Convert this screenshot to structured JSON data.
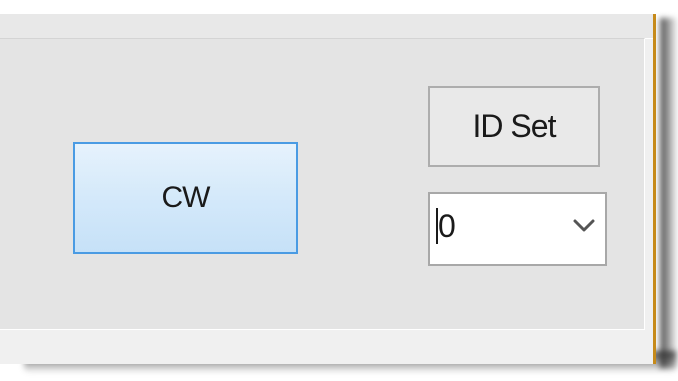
{
  "controls": {
    "cw_button_label": "CW",
    "id_set_button_label": "ID Set",
    "id_select": {
      "selected_value": "0"
    }
  },
  "icons": {
    "select_caret": "chevron-down-icon"
  },
  "colors": {
    "cw_button_border": "#4a9be3",
    "cw_button_fill": "#d4e9fa",
    "window_accent_border": "#c68a1a",
    "panel_background": "#e4e4e4"
  }
}
